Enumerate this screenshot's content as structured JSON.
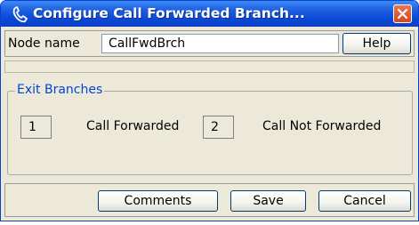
{
  "window": {
    "title": "Configure Call Forwarded Branch...",
    "title_icon": "handset-icon",
    "close_icon": "close-icon"
  },
  "node": {
    "label": "Node name",
    "value": "CallFwdBrch",
    "help_label": "Help"
  },
  "exit_branches": {
    "title": "Exit Branches",
    "branches": [
      {
        "index": "1",
        "label": "Call Forwarded"
      },
      {
        "index": "2",
        "label": "Call Not Forwarded"
      }
    ]
  },
  "buttons": {
    "comments": "Comments",
    "save": "Save",
    "cancel": "Cancel"
  },
  "colors": {
    "title_bar": "#0a48d6",
    "close_button": "#d4481f",
    "dialog_bg": "#ece9d8",
    "group_title": "#0046d5"
  }
}
